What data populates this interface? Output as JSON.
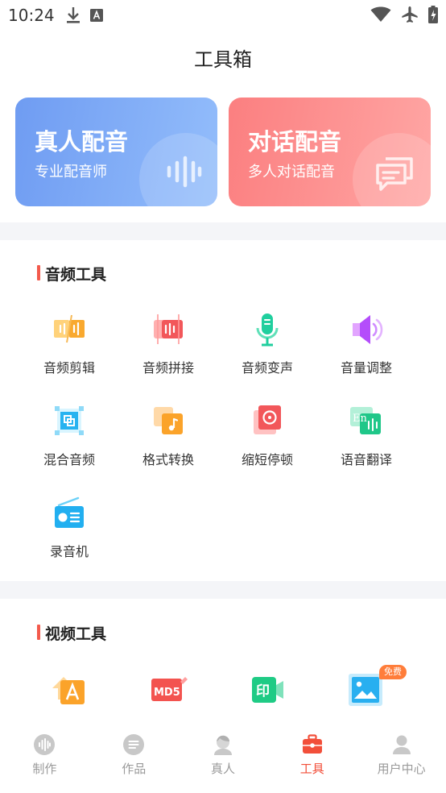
{
  "status_bar": {
    "time": "10:24"
  },
  "header": {
    "title": "工具箱"
  },
  "banners": [
    {
      "title": "真人配音",
      "subtitle": "专业配音师"
    },
    {
      "title": "对话配音",
      "subtitle": "多人对话配音"
    }
  ],
  "audio_section": {
    "title": "音频工具",
    "tools": [
      {
        "label": "音频剪辑",
        "icon": "audio-cut-icon"
      },
      {
        "label": "音频拼接",
        "icon": "audio-join-icon"
      },
      {
        "label": "音频变声",
        "icon": "microphone-icon"
      },
      {
        "label": "音量调整",
        "icon": "speaker-icon"
      },
      {
        "label": "混合音频",
        "icon": "mix-audio-icon"
      },
      {
        "label": "格式转换",
        "icon": "format-convert-icon"
      },
      {
        "label": "缩短停顿",
        "icon": "shorten-pause-icon"
      },
      {
        "label": "语音翻译",
        "icon": "translate-icon"
      },
      {
        "label": "录音机",
        "icon": "radio-recorder-icon"
      }
    ]
  },
  "video_section": {
    "title": "视频工具",
    "tools": [
      {
        "icon": "text-upload-icon"
      },
      {
        "icon": "md5-edit-icon",
        "icon_text": "MD5"
      },
      {
        "icon": "watermark-video-icon",
        "icon_text": "印"
      },
      {
        "icon": "image-icon",
        "badge": "免费"
      }
    ]
  },
  "bottom_nav": {
    "items": [
      {
        "label": "制作",
        "icon": "make-icon"
      },
      {
        "label": "作品",
        "icon": "works-icon"
      },
      {
        "label": "真人",
        "icon": "person-icon"
      },
      {
        "label": "工具",
        "icon": "toolbox-icon",
        "active": true
      },
      {
        "label": "用户中心",
        "icon": "user-center-icon"
      }
    ]
  },
  "colors": {
    "accent": "#f24f3a",
    "banner_blue": "#7fa9f6",
    "banner_red": "#fd8b8b",
    "nav_inactive": "#9a9a9a"
  }
}
